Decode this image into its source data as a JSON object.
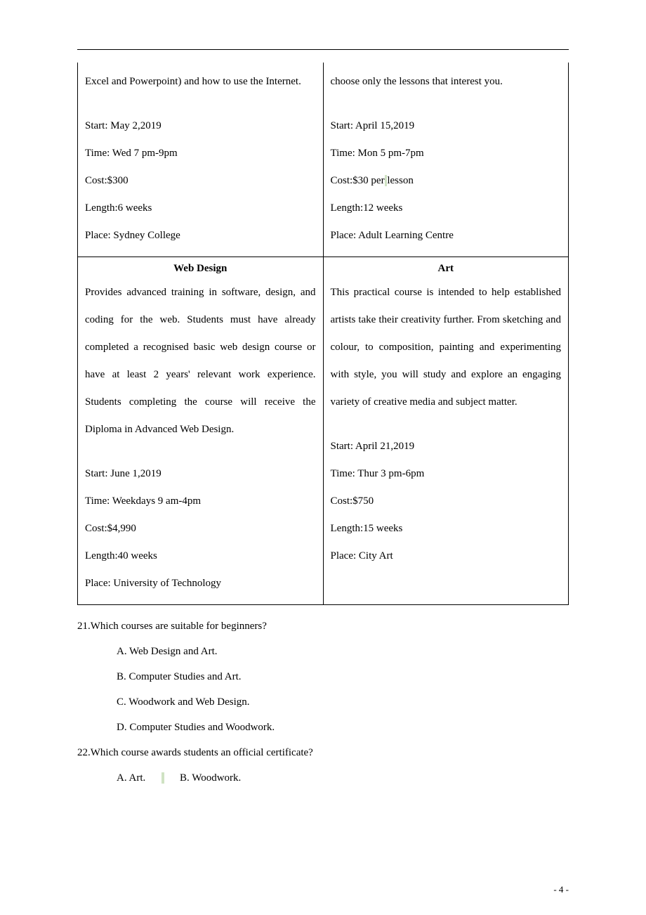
{
  "table": {
    "r1c1": {
      "desc_cont": "Excel and Powerpoint) and how to use the Internet.",
      "details": "Start: May 2,2019\nTime: Wed 7 pm-9pm\nCost:$300\nLength:6 weeks\nPlace: Sydney College"
    },
    "r1c2": {
      "desc_cont": "choose only the lessons that interest you.",
      "details_pre": "Start: April 15,2019\nTime: Mon 5 pm-7pm\nCost:$30 per",
      "details_hl": " ",
      "details_post": " lesson\nLength:12 weeks\nPlace: Adult Learning Centre"
    },
    "r2c1": {
      "title": "Web Design",
      "desc": "Provides advanced training in software, design, and coding for the web. Students must have already completed a recognised basic web design course or have at least 2 years' relevant work experience. Students completing the course will receive the Diploma in Advanced Web Design.",
      "details": "Start: June 1,2019\nTime: Weekdays 9 am-4pm\nCost:$4,990\nLength:40 weeks\nPlace: University of Technology"
    },
    "r2c2": {
      "title": "Art",
      "desc": "This practical course is intended to help established artists take their creativity further. From sketching and colour, to composition, painting and experimenting with style, you will study and explore an engaging variety of creative media and subject matter.",
      "details": "Start: April 21,2019\nTime: Thur 3 pm-6pm\nCost:$750\nLength:15 weeks\nPlace: City Art"
    }
  },
  "questions": {
    "q21": {
      "stem": "21.Which courses are suitable for beginners?",
      "A": "A. Web Design and Art.",
      "B": "B. Computer Studies and Art.",
      "C": "C. Woodwork and Web Design.",
      "D": "D. Computer Studies and Woodwork."
    },
    "q22": {
      "stem": "22.Which course awards students an official certificate?",
      "A": "A. Art.",
      "B": "B. Woodwork."
    }
  },
  "page_number": "- 4 -",
  "hl_between": " "
}
